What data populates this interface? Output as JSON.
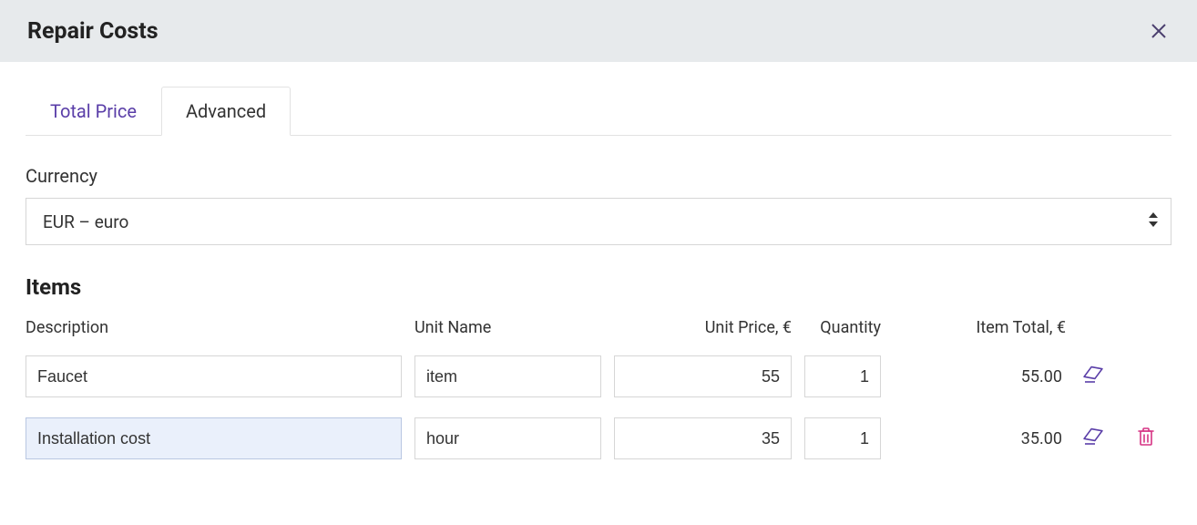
{
  "header": {
    "title": "Repair Costs"
  },
  "tabs": {
    "total_price": "Total Price",
    "advanced": "Advanced"
  },
  "currency": {
    "label": "Currency",
    "selected": "EUR – euro"
  },
  "items": {
    "heading": "Items",
    "columns": {
      "description": "Description",
      "unit_name": "Unit Name",
      "unit_price": "Unit Price, €",
      "quantity": "Quantity",
      "item_total": "Item Total, €"
    },
    "rows": [
      {
        "description": "Faucet",
        "unit_name": "item",
        "unit_price": "55",
        "quantity": "1",
        "item_total": "55.00",
        "selected": false,
        "show_delete": false
      },
      {
        "description": "Installation cost",
        "unit_name": "hour",
        "unit_price": "35",
        "quantity": "1",
        "item_total": "35.00",
        "selected": true,
        "show_delete": true
      }
    ]
  },
  "colors": {
    "accent": "#5a3ea8",
    "delete": "#d63384"
  }
}
